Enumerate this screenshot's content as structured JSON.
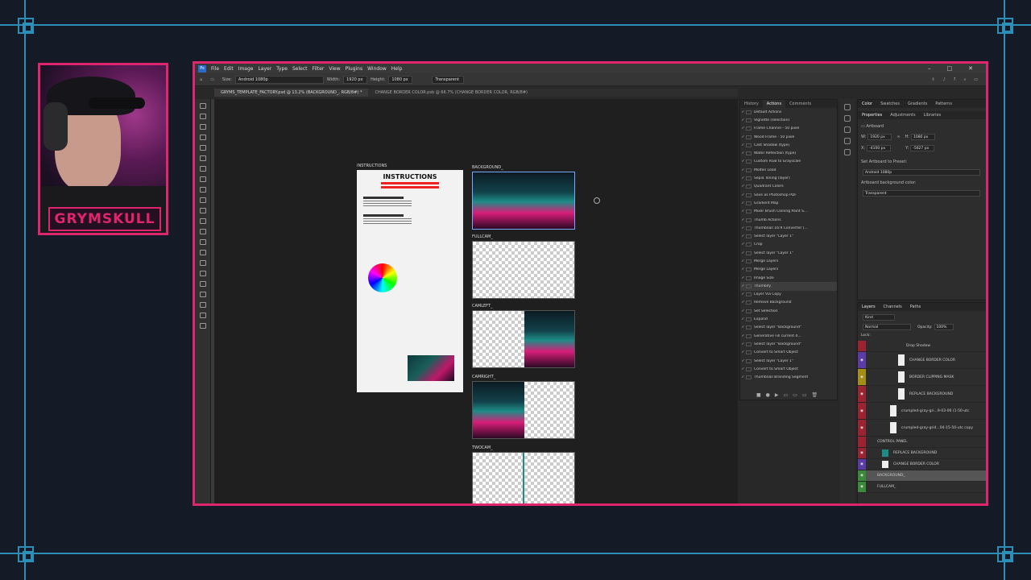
{
  "webcam": {
    "logo_text": "GRYMSKULL"
  },
  "app": {
    "logo": "Ps"
  },
  "menu": [
    "File",
    "Edit",
    "Image",
    "Layer",
    "Type",
    "Select",
    "Filter",
    "View",
    "Plugins",
    "Window",
    "Help"
  ],
  "options": {
    "size_label": "Size:",
    "size_value": "Android 1080p",
    "width_label": "Width:",
    "width_value": "1920 px",
    "height_label": "Height:",
    "height_value": "1080 px",
    "background_value": "Transparent"
  },
  "docs": [
    "GRYMS_TEMPLATE_FACTORY.psd @ 13.2% (BACKGROUND_, RGB/8#) *",
    "CHANGE BORDER COLOR.psb @ 66.7% (CHANGE BORDER COLOR, RGB/8#)"
  ],
  "artboards": [
    "INSTRUCTIONS",
    "BACKGROUND_",
    "FULLCAM_",
    "CAMLEFT_",
    "CAMRIGHT_",
    "TWOCAM_"
  ],
  "instructions": {
    "title": "INSTRUCTIONS"
  },
  "actions_tabs": [
    "History",
    "Actions",
    "Comments"
  ],
  "actions": [
    "Default Actions",
    "Vignette (selection)",
    "Frame Channel - 50 pixel",
    "Wood Frame - 50 pixel",
    "Cast Shadow (type)",
    "Water Reflection (type)",
    "Custom RGB to Grayscale",
    "Molten Lead",
    "Sepia Toning (layer)",
    "Quadrant Colors",
    "Save as Photoshop PDF",
    "Gradient Map",
    "Mixer Brush Cloning Paint S...",
    "Thumb Actions",
    "Thumbnail 16:9 Converter (...",
    "Select layer \"Layer 1\"",
    "Crop",
    "Select layer \"Layer 1\"",
    "Merge Layers",
    "Merge Layers",
    "Image Size",
    "Thumbify",
    "Layer Via Copy",
    "Remove Background",
    "Set Selection",
    "Expand",
    "Select layer \"Background\"",
    "Generative Fill current d...",
    "Select layer \"Background\"",
    "Convert to Smart Object",
    "Select layer \"Layer 1\"",
    "Convert to Smart Object",
    "Thumbnail Branding Segment"
  ],
  "color_tabs": [
    "Color",
    "Swatches",
    "Gradients",
    "Patterns"
  ],
  "prop_tabs": [
    "Properties",
    "Adjustments",
    "Libraries"
  ],
  "properties": {
    "type": "Artboard",
    "w_label": "W:",
    "w": "1920 px",
    "h_label": "H:",
    "h": "1080 px",
    "x_label": "X:",
    "x": "-4100 px",
    "y_label": "Y:",
    "y": "-5627 px",
    "preset_label": "Set Artboard to Preset:",
    "preset_value": "Android 1080p",
    "bg_label": "Artboard background color:",
    "bg_value": "Transparent"
  },
  "layer_tabs": [
    "Layers",
    "Channels",
    "Paths"
  ],
  "layers_ui": {
    "kind": "Kind",
    "blend": "Normal",
    "opacity_label": "Opacity:",
    "opacity": "100%",
    "lock_label": "Lock:"
  },
  "layers": [
    "Drop Shadow",
    "CHANGE BORDER COLOR",
    "BORDER CLIPPING MASK",
    "REPLACE BACKGROUND",
    "crumpled-gray-gri...9-03-06 (1-50-utc",
    "crumpled-gray-grid...04-15-50-utc copy",
    "CONTROL PANEL",
    "REPLACE BACKGROUND",
    "CHANGE BORDER COLOR",
    "BACKGROUND_",
    "FULLCAM_"
  ]
}
